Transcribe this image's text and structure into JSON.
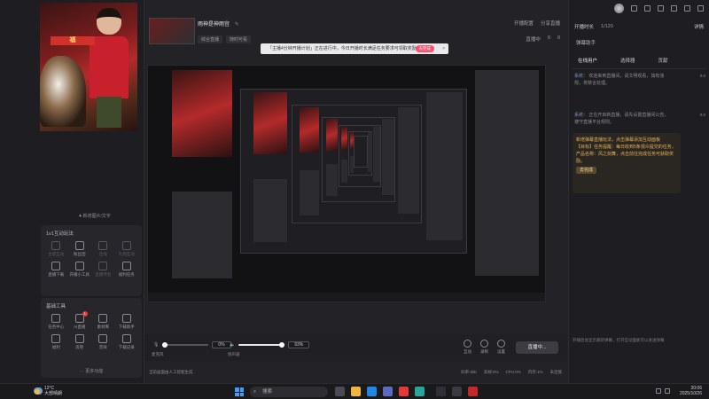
{
  "left_panel": {
    "add_scene_label": "新增图片/文字",
    "live_tools": {
      "title": "1v1互动玩法",
      "items": [
        {
          "label": "主题互动",
          "icon": "mic-icon",
          "dim": true
        },
        {
          "label": "粉丝团",
          "icon": "shield-icon",
          "dim": false
        },
        {
          "label": "连线",
          "icon": "link-icon",
          "dim": true
        },
        {
          "label": "礼物互动",
          "icon": "gift-icon",
          "dim": true
        },
        {
          "label": "直播下载",
          "icon": "download-icon",
          "dim": false
        },
        {
          "label": "开播小工具",
          "icon": "grid-icon",
          "dim": false
        },
        {
          "label": "直播伴侣",
          "icon": "record-icon",
          "dim": true
        },
        {
          "label": "福利任务",
          "icon": "task-icon",
          "dim": false
        }
      ]
    },
    "basic_tools": {
      "title": "基础工具",
      "items": [
        {
          "label": "任务中心",
          "icon": "clipboard-icon",
          "badge": ""
        },
        {
          "label": "AI直播",
          "icon": "ai-icon",
          "badge": "1"
        },
        {
          "label": "素材库",
          "icon": "image-icon",
          "badge": ""
        },
        {
          "label": "下载助手",
          "icon": "download-icon",
          "badge": ""
        },
        {
          "label": "福利",
          "icon": "chat-icon",
          "badge": ""
        },
        {
          "label": "房管",
          "icon": "shield-icon",
          "badge": ""
        },
        {
          "label": "音效",
          "icon": "sound-icon",
          "badge": ""
        },
        {
          "label": "下载记录",
          "icon": "record-icon",
          "badge": ""
        }
      ],
      "more_label": "更多功能"
    }
  },
  "header": {
    "room_title": "雨神是神雨宫",
    "tags": [
      "综合直播",
      "随时可看"
    ],
    "right_top": [
      "开播配置",
      "分享直播"
    ],
    "right_bottom": [
      "直播中",
      "0",
      "0"
    ]
  },
  "notice": {
    "text": "「主播4分钟开播计划」正在进行中，今日开播时长满足任务要求可领取奖励",
    "action_label": "去完成"
  },
  "bottom": {
    "mic_label": "麦克风",
    "mic_pct": "0%",
    "mic_level": 0.0,
    "speaker_label": "扬声器",
    "speaker_pct": "93%",
    "speaker_level": 0.93,
    "tools": [
      {
        "label": "互动",
        "icon": "interact-icon"
      },
      {
        "label": "录制",
        "icon": "camera-icon"
      },
      {
        "label": "设置",
        "icon": "gear-icon"
      }
    ],
    "live_button": "直播中..."
  },
  "status": {
    "left": "当前画面由人工智能生成",
    "right": [
      "码率:0kb",
      "丢帧:0%",
      "CPU:0%",
      "内存:1%",
      "未连接"
    ]
  },
  "right_panel": {
    "header": {
      "tab": "开播时长",
      "count": "1/120",
      "action": "详情"
    },
    "assistant_title": "弹幕助手",
    "tabs": [
      "在线用户",
      "选择器",
      "贡献"
    ],
    "messages": [
      {
        "name": "系统",
        "text": "欢迎来到直播间，请文明观看，如有违规，将禁言处理。"
      },
      {
        "name": "系统",
        "text": "正在开启新直播，请先设置直播间公告，遵守直播平台规则。"
      }
    ],
    "side_notes": [
      "0.0",
      "0.0"
    ],
    "system_box": {
      "title": "新增弹幕直播玩法，点击弹幕添加互动面板",
      "body": "【目标】任务提醒：每日收到5条观众提交的任务，产品名称：风之剑舞，点击前往完成任务可获取奖励。",
      "button": "去完成"
    },
    "input_hint": "开播后会显示最新弹幕，打开互动面板可以发送弹幕"
  },
  "taskbar": {
    "weather_temp": "12°C",
    "weather_desc": "大部晴朗",
    "search_placeholder": "搜索",
    "time": "20:06",
    "date": "2025/10/26"
  }
}
